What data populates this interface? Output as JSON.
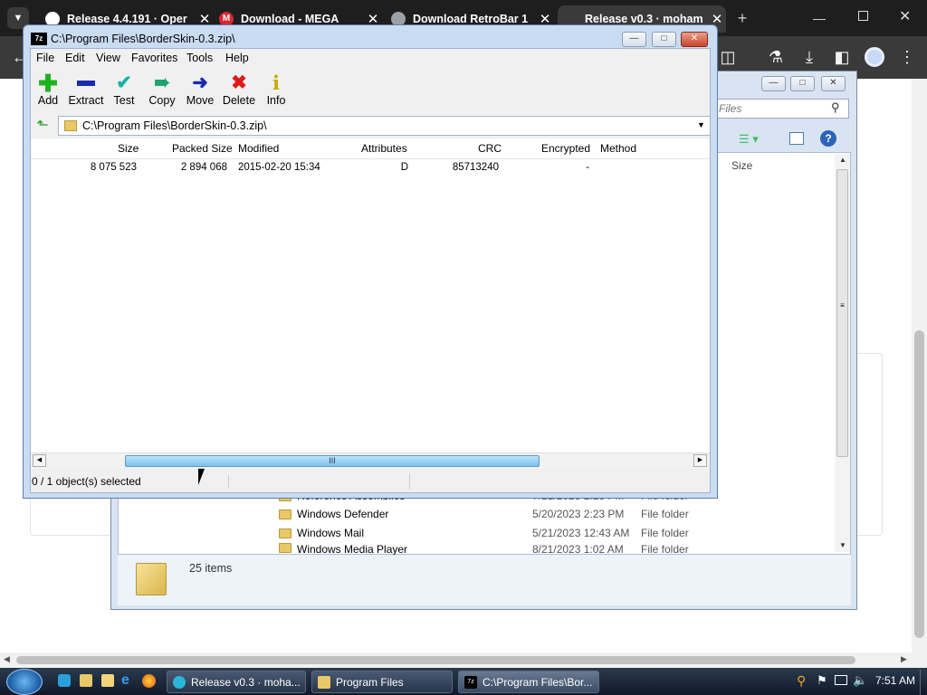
{
  "browser": {
    "tabs": [
      {
        "label": "Release 4.4.191 · Oper",
        "favicon": "github-icon"
      },
      {
        "label": "Download - MEGA",
        "favicon": "mega-icon"
      },
      {
        "label": "Download RetroBar 1",
        "favicon": "retrobar-icon"
      },
      {
        "label": "Release v0.3 · moham",
        "favicon": "github-icon",
        "active": true
      }
    ],
    "new_tab": "+",
    "toolbar_icons": [
      "extensions-icon",
      "labs-icon",
      "download-icon",
      "sidepanel-icon",
      "profile-icon",
      "more-icon"
    ]
  },
  "explorer": {
    "search_placeholder": "Files",
    "column_size": "Size",
    "rows": [
      {
        "name": "Reference Assemblies",
        "date": "7/21/2023 2:23 PM",
        "type": "File folder"
      },
      {
        "name": "Windows Defender",
        "date": "5/20/2023 2:23 PM",
        "type": "File folder"
      },
      {
        "name": "Windows Mail",
        "date": "5/21/2023 12:43 AM",
        "type": "File folder"
      },
      {
        "name": "Windows Media Player",
        "date": "8/21/2023 1:02 AM",
        "type": "File folder"
      }
    ],
    "item_count": "25 items"
  },
  "zip": {
    "title": "C:\\Program Files\\BorderSkin-0.3.zip\\",
    "menu": [
      "File",
      "Edit",
      "View",
      "Favorites",
      "Tools",
      "Help"
    ],
    "tools": [
      {
        "label": "Add",
        "icon": "add-icon",
        "color": "#1db31d"
      },
      {
        "label": "Extract",
        "icon": "extract-icon",
        "color": "#1a2bb0"
      },
      {
        "label": "Test",
        "icon": "test-icon",
        "color": "#17b3a6"
      },
      {
        "label": "Copy",
        "icon": "copy-icon",
        "color": "#19a36a"
      },
      {
        "label": "Move",
        "icon": "move-icon",
        "color": "#1a2bb0"
      },
      {
        "label": "Delete",
        "icon": "delete-icon",
        "color": "#e01818"
      },
      {
        "label": "Info",
        "icon": "info-icon",
        "color": "#c8a800"
      }
    ],
    "address": "C:\\Program Files\\BorderSkin-0.3.zip\\",
    "columns": [
      "Size",
      "Packed Size",
      "Modified",
      "Attributes",
      "CRC",
      "Encrypted",
      "Method"
    ],
    "row": {
      "size": "8 075 523",
      "packed": "2 894 068",
      "modified": "2015-02-20 15:34",
      "attributes": "D",
      "crc": "85713240",
      "encrypted": "-",
      "method": ""
    },
    "status": "0 / 1 object(s) selected",
    "scroll_grip": "III"
  },
  "taskbar": {
    "items": [
      {
        "label": "Release v0.3 · moha...",
        "icon": "chrome-icon"
      },
      {
        "label": "Program Files",
        "icon": "folder-icon"
      },
      {
        "label": "C:\\Program Files\\Bor...",
        "icon": "7zip-icon"
      }
    ],
    "time": "7:51 AM"
  }
}
